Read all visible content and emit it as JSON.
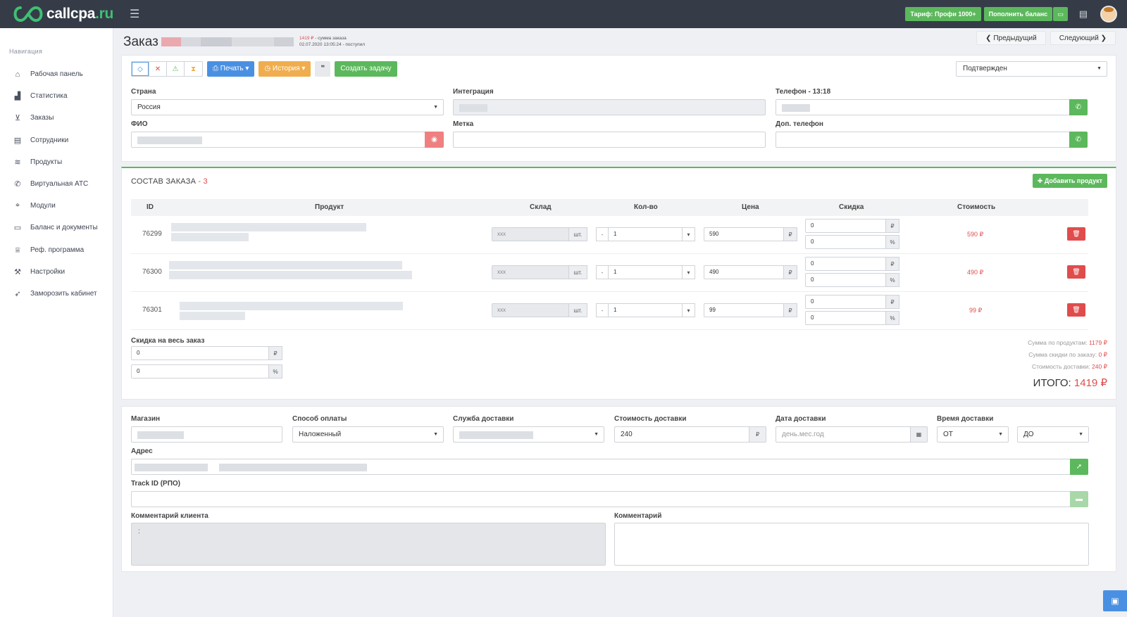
{
  "header": {
    "logo_text": "callcpa",
    "logo_domain": ".ru",
    "tariff_button": "Тариф: Профи 1000+",
    "balance_button": "Пополнить баланс"
  },
  "sidebar": {
    "title": "Навигация",
    "items": [
      {
        "label": "Рабочая панель",
        "icon": "home-icon"
      },
      {
        "label": "Статистика",
        "icon": "bar-chart-icon"
      },
      {
        "label": "Заказы",
        "icon": "cart-icon"
      },
      {
        "label": "Сотрудники",
        "icon": "id-card-icon"
      },
      {
        "label": "Продукты",
        "icon": "layers-icon"
      },
      {
        "label": "Виртуальная АТС",
        "icon": "phone-icon"
      },
      {
        "label": "Модули",
        "icon": "tag-icon"
      },
      {
        "label": "Баланс и документы",
        "icon": "folder-icon"
      },
      {
        "label": "Реф. программа",
        "icon": "trophy-icon"
      },
      {
        "label": "Настройки",
        "icon": "wrench-icon"
      },
      {
        "label": "Заморозить кабинет",
        "icon": "rocket-icon"
      }
    ]
  },
  "order": {
    "title": "Заказ",
    "sum_value": "1419 ₽",
    "sum_label": " - сумма заказа",
    "datetime": "02.07.2020 13:05:24 - поступил",
    "prev_label": "Предыдущий",
    "next_label": "Следующий"
  },
  "toolbar": {
    "print_label": "Печать",
    "history_label": "История",
    "quote_label": "❞",
    "create_task_label": "Создать задачу",
    "status_value": "Подтвержден"
  },
  "contact": {
    "country_label": "Страна",
    "country_value": "Россия",
    "integration_label": "Интеграция",
    "phone_label": "Телефон - 13:18",
    "fio_label": "ФИО",
    "tag_label": "Метка",
    "extra_phone_label": "Доп. телефон"
  },
  "composition": {
    "title": "СОСТАВ ЗАКАЗА",
    "count": " - 3",
    "add_product_label": "Добавить продукт",
    "columns": [
      "ID",
      "Продукт",
      "Склад",
      "Кол-во",
      "Цена",
      "Скидка",
      "Стоимость"
    ],
    "unit": "шт.",
    "stock_value": "ххх",
    "minus": "-",
    "currency": "₽",
    "percent": "%",
    "rows": [
      {
        "id": "76299",
        "qty": "1",
        "price": "590",
        "disc_rub": "0",
        "disc_pct": "0",
        "cost": "590 ₽"
      },
      {
        "id": "76300",
        "qty": "1",
        "price": "490",
        "disc_rub": "0",
        "disc_pct": "0",
        "cost": "490 ₽"
      },
      {
        "id": "76301",
        "qty": "1",
        "price": "99",
        "disc_rub": "0",
        "disc_pct": "0",
        "cost": "99 ₽"
      }
    ],
    "order_discount_label": "Скидка на весь заказ",
    "order_discount_rub": "0",
    "order_discount_pct": "0",
    "products_sum_label": "Сумма по продуктам:",
    "products_sum_value": "1179 ₽",
    "discount_sum_label": "Сумма скидки по заказу:",
    "discount_sum_value": "0 ₽",
    "delivery_cost_label": "Стоимость доставки:",
    "delivery_cost_value": "240 ₽",
    "total_label": "ИТОГО:",
    "total_value": "1419 ₽"
  },
  "delivery": {
    "shop_label": "Магазин",
    "payment_label": "Способ оплаты",
    "payment_value": "Наложенный",
    "service_label": "Служба доставки",
    "cost_label": "Стоимость доставки",
    "cost_value": "240",
    "date_label": "Дата доставки",
    "date_placeholder": "день.мес.год",
    "time_label": "Время доставки",
    "time_from": "ОТ",
    "time_to": "ДО",
    "address_label": "Адрес",
    "track_label": "Track ID (РПО)",
    "client_comment_label": "Комментарий клиента",
    "client_comment_value": ":",
    "comment_label": "Комментарий"
  }
}
